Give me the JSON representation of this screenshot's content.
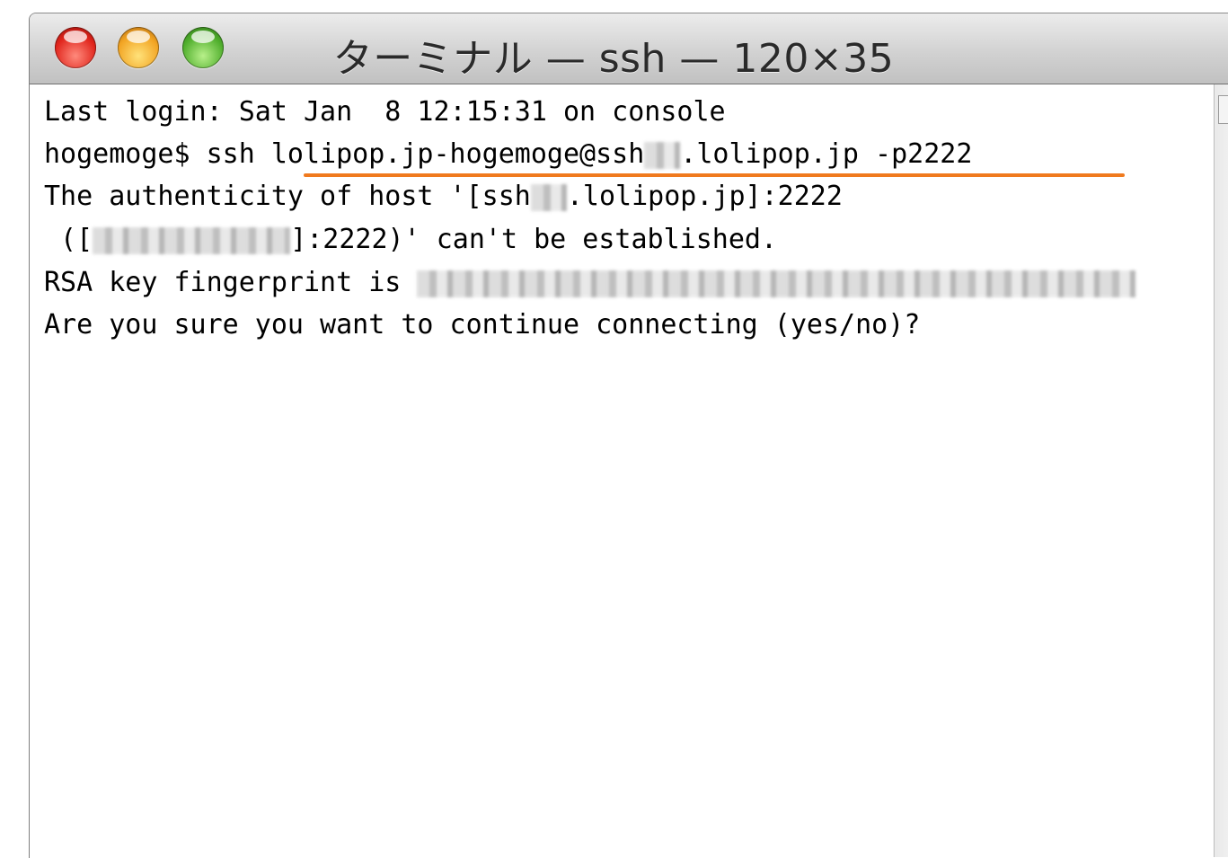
{
  "window": {
    "title": "ターミナル — ssh — 120×35"
  },
  "terminal": {
    "line1": "Last login: Sat Jan  8 12:15:31 on console",
    "line2_prompt": "hogemoge$ ssh ",
    "line2_user": "lolipop.jp-hogemoge@ssh",
    "line2_rest": ".lolipop.jp -p2222",
    "line3_start": "The authenticity of host '[ssh",
    "line3_end": ".lolipop.jp]:2222",
    "line4_start": " ([",
    "line4_end": "]:2222)' can't be established.",
    "line5": "RSA key fingerprint is ",
    "line6": "Are you sure you want to continue connecting (yes/no)?"
  },
  "colors": {
    "highlight_underline": "#f07a1e",
    "close": "#e0241b",
    "minimize": "#f2a423",
    "zoom": "#4fae2c"
  },
  "icons": {
    "close": "close-button",
    "minimize": "minimize-button",
    "zoom": "zoom-button"
  }
}
